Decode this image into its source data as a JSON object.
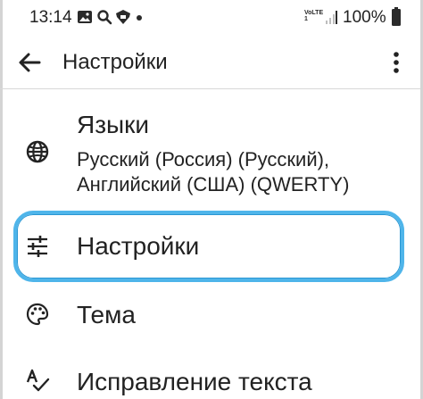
{
  "status_bar": {
    "time": "13:14",
    "notification_icons": [
      "image-icon",
      "search-icon",
      "shield-icon",
      "dot-icon"
    ],
    "network_label": "VoLTE1",
    "battery": "100%"
  },
  "app_bar": {
    "title": "Настройки",
    "back_icon": "arrow-back-icon",
    "menu_icon": "more-vert-icon"
  },
  "list": {
    "items": [
      {
        "title": "Языки",
        "subtitle_line1": "Русский (Россия) (Русский),",
        "subtitle_line2": "Английский (США) (QWERTY)",
        "icon": "globe-icon"
      },
      {
        "title": "Настройки",
        "icon": "tune-icon",
        "highlighted": true
      },
      {
        "title": "Тема",
        "icon": "palette-icon"
      },
      {
        "title": "Исправление текста",
        "icon": "spellcheck-icon"
      }
    ]
  },
  "colors": {
    "highlight": "#4fb5ea",
    "text": "#222222",
    "divider": "#d8d8d8"
  }
}
